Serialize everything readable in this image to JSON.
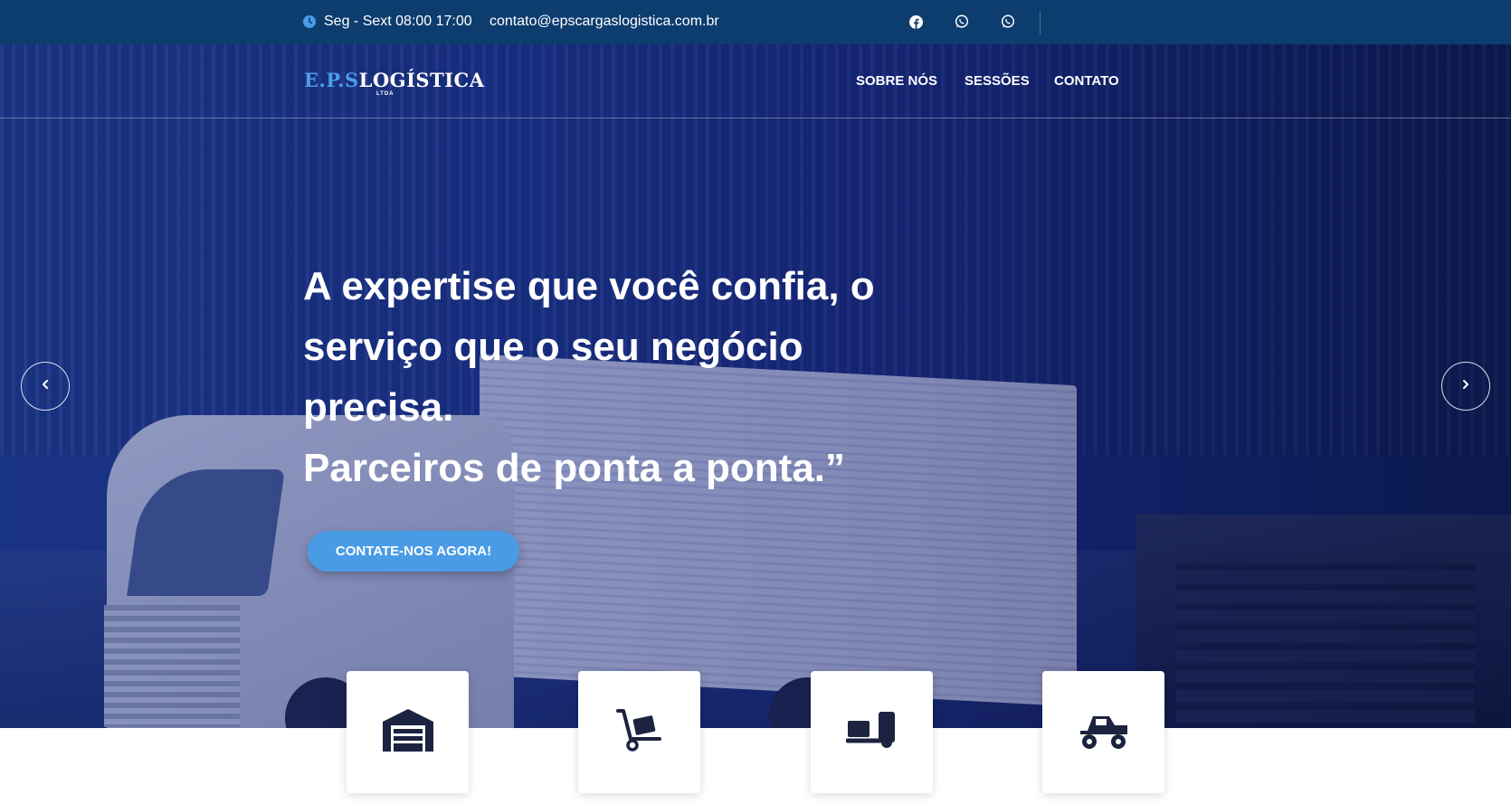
{
  "topbar": {
    "hours": "Seg - Sext 08:00 17:00",
    "email": "contato@epscargaslogistica.com.br",
    "icons": [
      "clock-icon",
      "facebook-icon",
      "whatsapp-icon",
      "whatsapp-icon"
    ]
  },
  "header": {
    "logo": {
      "part1": "E.P.S",
      "part2": "LOGÍSTICA",
      "sub": "LTDA"
    },
    "nav": [
      "SOBRE NÓS",
      "SESSÕES",
      "CONTATO"
    ]
  },
  "hero": {
    "headline": [
      "A expertise que você confia, o",
      "serviço que o seu negócio",
      "precisa.",
      "Parceiros de ponta a ponta.”"
    ],
    "cta": "CONTATE-NOS AGORA!",
    "arrows": [
      "chevron-left-icon",
      "chevron-right-icon"
    ]
  },
  "services": {
    "icons": [
      "warehouse-icon",
      "hand-truck-icon",
      "dolly-icon",
      "monster-truck-icon"
    ]
  },
  "colors": {
    "topbar": "#0d3d6e",
    "accent": "#4a9be6",
    "icon_dark": "#1c2340",
    "white": "#ffffff"
  }
}
